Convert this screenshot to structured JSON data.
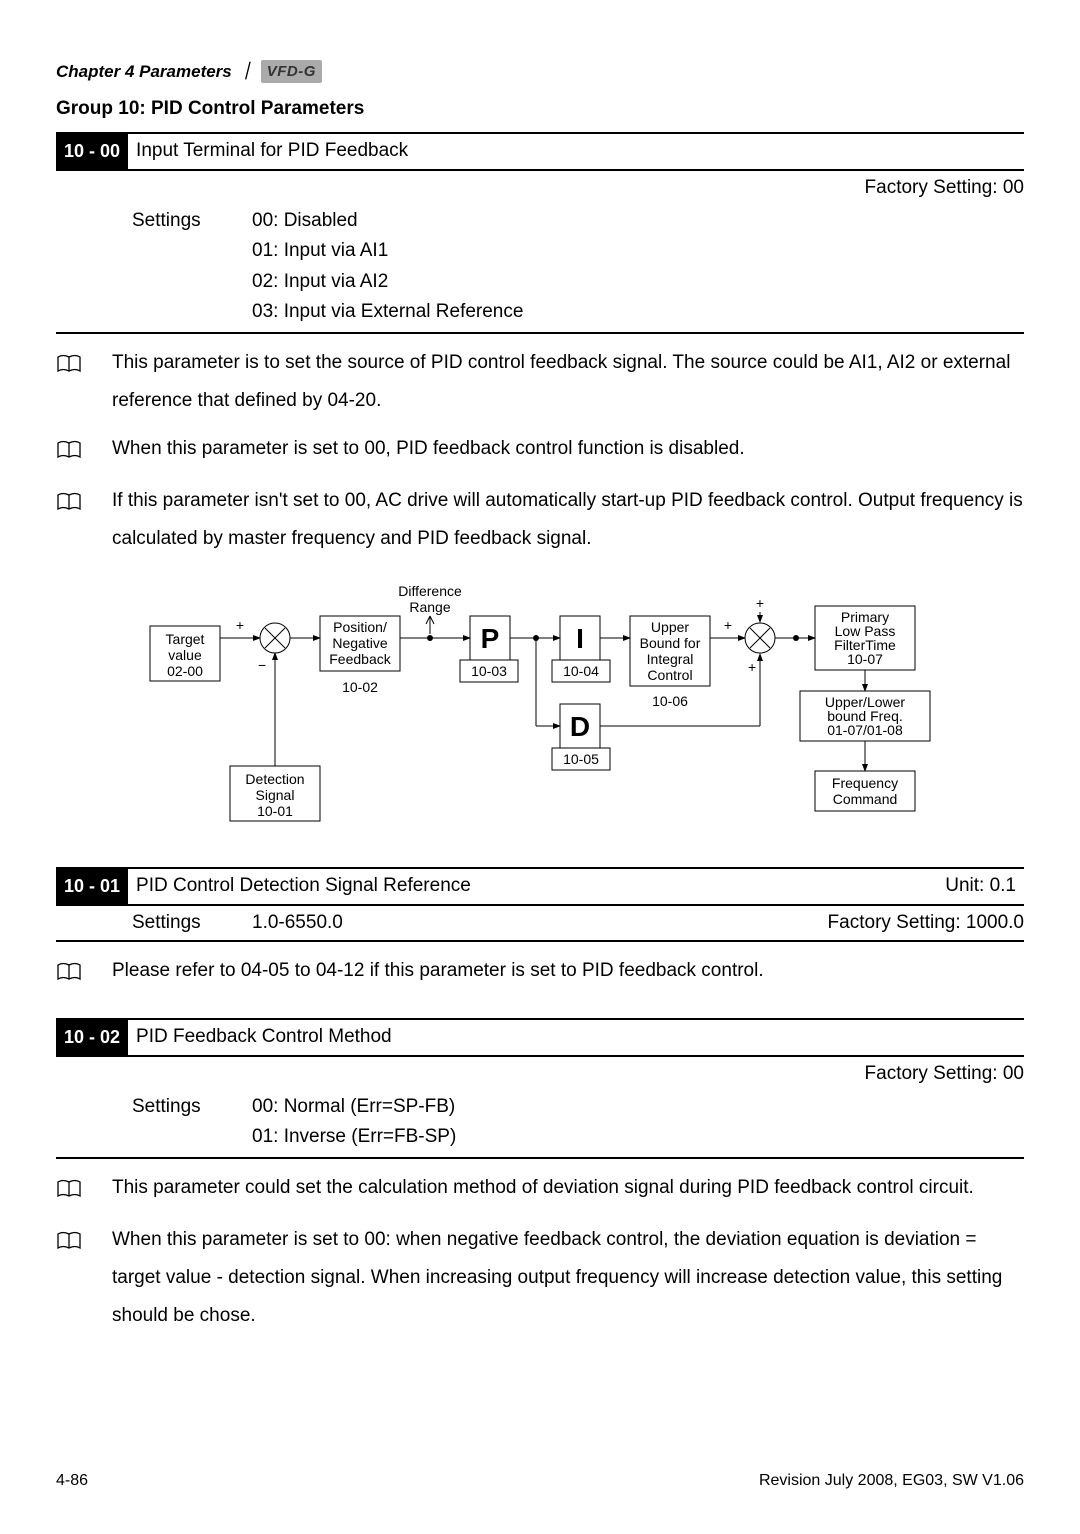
{
  "header": {
    "chapter": "Chapter 4 Parameters",
    "separator": "｜",
    "brand": "VFD-G"
  },
  "group_title": "Group 10: PID Control Parameters",
  "params": [
    {
      "code": "10 - 00",
      "name": "Input Terminal for PID Feedback",
      "factory": "Factory Setting: 00",
      "settings_label": "Settings",
      "options": [
        "00: Disabled",
        "01: Input via AI1",
        "02: Input via AI2",
        "03: Input via External Reference"
      ],
      "notes": [
        "This parameter is to set the source of PID control feedback signal. The source could be AI1, AI2 or external reference that defined by 04-20.",
        "When this parameter is set to 00, PID feedback control function is disabled.",
        "If this parameter isn't set to 00, AC drive will automatically start-up PID feedback control. Output frequency is calculated by master frequency and PID feedback signal."
      ]
    },
    {
      "code": "10 - 01",
      "name": "PID Control Detection Signal Reference",
      "unit": "Unit: 0.1",
      "settings_label": "Settings",
      "range": "1.0-6550.0",
      "factory_inline": "Factory Setting: 1000.0",
      "notes": [
        "Please refer to 04-05 to 04-12 if this parameter is set to PID feedback control."
      ]
    },
    {
      "code": "10 - 02",
      "name": "PID Feedback Control Method",
      "factory": "Factory Setting: 00",
      "settings_label": "Settings",
      "options": [
        "00: Normal (Err=SP-FB)",
        "01: Inverse (Err=FB-SP)"
      ],
      "notes": [
        "This parameter could set the calculation method of deviation signal during PID feedback control circuit.",
        "When this parameter is set to 00: when negative feedback control, the deviation equation is deviation = target value - detection signal. When increasing output frequency will increase detection value, this setting should be chose."
      ]
    }
  ],
  "diagram": {
    "labels": {
      "target": "Target value 02-00",
      "detection": "Detection Signal 10-01",
      "posneg": "Position/ Negative Feedback",
      "posneg_code": "10-02",
      "diff": "Difference Range",
      "p": "P",
      "p_code": "10-03",
      "i": "I",
      "i_code": "10-04",
      "d": "D",
      "d_code": "10-05",
      "upper": "Upper Bound for Integral Control",
      "upper_code": "10-06",
      "lowpass": "Primary Low Pass FilterTime 10-07",
      "bound": "Upper/Lower bound Freq. 01-07/01-08",
      "freqcmd": "Frequency Command"
    }
  },
  "footer": {
    "page": "4-86",
    "rev": "Revision July 2008, EG03, SW V1.06"
  }
}
